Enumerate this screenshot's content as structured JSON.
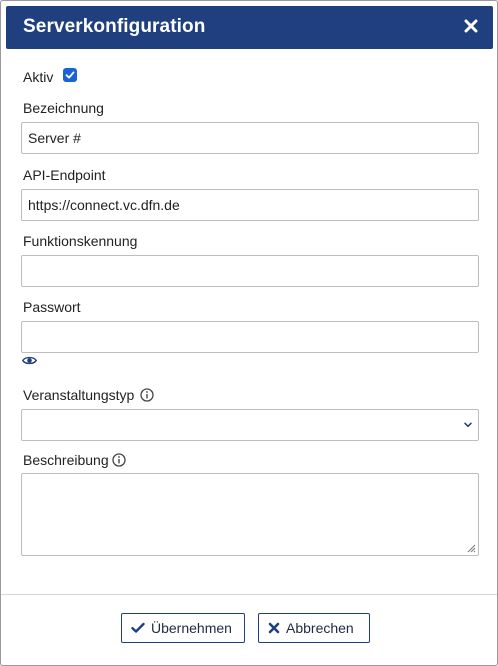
{
  "dialog": {
    "title": "Serverkonfiguration",
    "close_icon": "close-icon"
  },
  "form": {
    "active": {
      "label": "Aktiv",
      "checked": true
    },
    "name": {
      "label": "Bezeichnung",
      "value": "Server #"
    },
    "api_endpoint": {
      "label": "API-Endpoint",
      "value": "https://connect.vc.dfn.de"
    },
    "function_id": {
      "label": "Funktionskennung",
      "value": ""
    },
    "password": {
      "label": "Passwort",
      "value": "",
      "toggle_icon": "eye-icon"
    },
    "event_type": {
      "label": "Veranstaltungstyp",
      "value": "",
      "info_icon": "info-icon"
    },
    "description": {
      "label": "Beschreibung",
      "value": "",
      "info_icon": "info-icon"
    }
  },
  "buttons": {
    "apply": {
      "label": "Übernehmen",
      "icon": "check-icon"
    },
    "cancel": {
      "label": "Abbrechen",
      "icon": "x-icon"
    }
  },
  "colors": {
    "header_bg": "#1f3f7f",
    "checkbox": "#1a62d6",
    "icon_blue": "#1f3f7f"
  }
}
